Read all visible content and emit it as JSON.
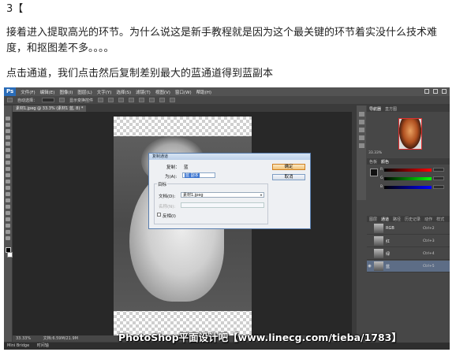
{
  "article": {
    "step": "3【",
    "line1": "接着进入提取高光的环节。为什么说这是新手教程就是因为这个最关键的环节着实没什么技术难度，和抠图差不多。。。。",
    "line3": "点击通道，我们点击然后复制差别最大的蓝通道得到蓝副本"
  },
  "photoshop": {
    "logo": "Ps",
    "menu": [
      "文件(F)",
      "编辑(E)",
      "图像(I)",
      "图层(L)",
      "文字(Y)",
      "选择(S)",
      "滤镜(T)",
      "视图(V)",
      "窗口(W)",
      "帮助(H)"
    ],
    "options": {
      "auto_select": "自动选择：",
      "show_transform": "显示变换控件"
    },
    "doc_tab": "素材1.jpeg @ 33.3% (素材1 蓝, 8) *",
    "status": {
      "zoom": "33.33%",
      "doc_size": "文档:6.59M/21.9M"
    },
    "bridge_tabs": [
      "Mini Bridge",
      "时间轴"
    ],
    "panels": {
      "nav_tabs": [
        "导航器",
        "直方图"
      ],
      "nav_zoom": "33.33%",
      "color_tabs": [
        "色板",
        "颜色"
      ],
      "sliders": [
        "R",
        "G",
        "B"
      ],
      "layer_tabs": [
        "图层",
        "通道",
        "路径",
        "历史记录",
        "动作",
        "样式"
      ],
      "channels": [
        {
          "name": "RGB",
          "key": "Ctrl+2",
          "selected": false
        },
        {
          "name": "红",
          "key": "Ctrl+3",
          "selected": false
        },
        {
          "name": "绿",
          "key": "Ctrl+4",
          "selected": false
        },
        {
          "name": "蓝",
          "key": "Ctrl+5",
          "selected": true
        }
      ]
    },
    "dialog": {
      "title": "复制通道",
      "copy_label": "复制：",
      "copy_value": "蓝",
      "as_label": "为(A):",
      "as_value": "蓝 副本",
      "target_label": "目标",
      "doc_label": "文档(D):",
      "doc_value": "素材1.jpeg",
      "name_label": "名称(N):",
      "invert_label": "反相(I)",
      "ok_label": "确定",
      "cancel_label": "取消"
    }
  },
  "watermark": "PhotoShop平面设计吧【www.linecg.com/tieba/1783】"
}
